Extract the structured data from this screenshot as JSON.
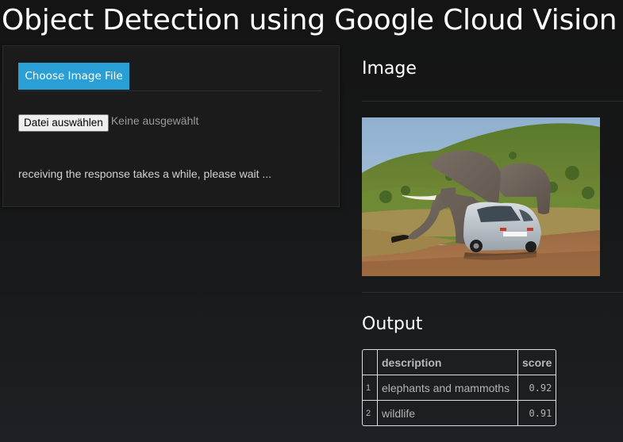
{
  "page": {
    "title": "Object Detection using Google Cloud Vision"
  },
  "left_panel": {
    "tab_label": "Choose Image File",
    "file_input": {
      "button_label": "Datei auswählen",
      "status": "Keine ausgewählt"
    },
    "wait_message": "receiving the response takes a while, please wait ..."
  },
  "image_section": {
    "heading": "Image",
    "image_subject": "elephant leaning on a silver car on a dirt road"
  },
  "output_section": {
    "heading": "Output",
    "table": {
      "columns": [
        "",
        "description",
        "score"
      ],
      "rows": [
        {
          "index": "1",
          "description": "elephants and mammoths",
          "score": "0.92"
        },
        {
          "index": "2",
          "description": "wildlife",
          "score": "0.91"
        }
      ]
    }
  },
  "colors": {
    "accent": "#2a9fd6",
    "background": "#151515",
    "panel": "#1b1b1c"
  }
}
